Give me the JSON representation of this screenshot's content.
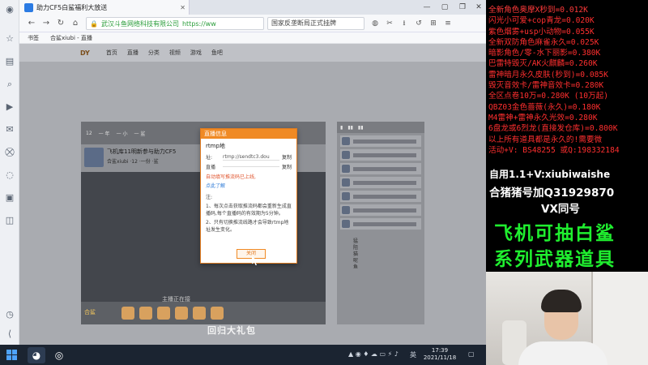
{
  "browser": {
    "tab_title": "助力CF5白鲨福利大放送",
    "site_name": "武汉斗鱼网络科技有限公司",
    "url": "https://ww",
    "search_text": "国家反垄断局正式挂牌",
    "bookmarks": [
      "书签",
      "合鲨xiubi - 直播"
    ]
  },
  "page": {
    "nav": [
      "首页",
      "直播",
      "分类",
      "视频",
      "游戏",
      "鱼吧"
    ],
    "live_top": [
      "12",
      "一 年",
      "一 小",
      "一 鲨"
    ],
    "streamer_title": "飞机库11明新参与助力CF5",
    "streamer_sub": "合鲨xiubi   ·12  ·一份  ·鲨",
    "notice": "主播正在接",
    "room_tag": "合鲨",
    "chat_lines": "猛\n阻\n猫\n呢\n鱼",
    "footer": "回归大礼包"
  },
  "dialog": {
    "header": "直播信息",
    "title": "rtmp地",
    "field1_key": "址:",
    "field1_val": "rtmp://sendtc3.dou",
    "field2_key": "直播",
    "field2_val": "",
    "copy_label": "复制",
    "warn": "自动填写推流码已上线,",
    "link": "点此了解",
    "note_title": "注:",
    "note1": "1、每次点击获取推流码都会重新生成直播码,每个直播码的有效期为5分钟。",
    "note2": "2、只有切换推流线路才会导致rtmp地址发生变化。",
    "ok": "关闭"
  },
  "taskbar": {
    "clock_time": "17:39",
    "clock_date": "2021/11/18",
    "ime": "英",
    "apps": [
      "start-icon",
      "browser-app-icon",
      "obs-app-icon"
    ]
  },
  "promo": {
    "lines": [
      "全新角色奥摩X秒到=0.012K",
      "闪光小可爱+cop青龙=0.020K",
      "紫色烟雾+usp小动物=0.055K",
      "全新双防角色麻雀永久=0.025K",
      "暗影角色/零-水下丽影=0.380K",
      "巴雷特毁灭/AK火麒麟=0.260K",
      "雷神暗月永久皮肤(秒到)=0.085K",
      "毁灭音效卡/雷神音效卡=0.280K",
      "全区点卷10万=0.280K (10万起)",
      "QBZ03金色蔷薇(永久)=0.180K",
      "M4雷神+雷神永久光效=0.280K",
      "6盘龙或6烈龙(直接发仓库)=0.800K",
      "以上所有道具都是永久的!需要微",
      "活动+V: BS48255  或Q:198332184"
    ],
    "line1": "自用1.1+V:xiubiwaishe",
    "line2": "合猪猪号加Q31929870",
    "line3": "VX同号",
    "big1": "飞机可抽白鲨",
    "big2": "系列武器道具"
  },
  "colors": {
    "promo_red": "#ff2f2f",
    "promo_green": "#1fef2f",
    "dialog_orange": "#f08a24"
  }
}
